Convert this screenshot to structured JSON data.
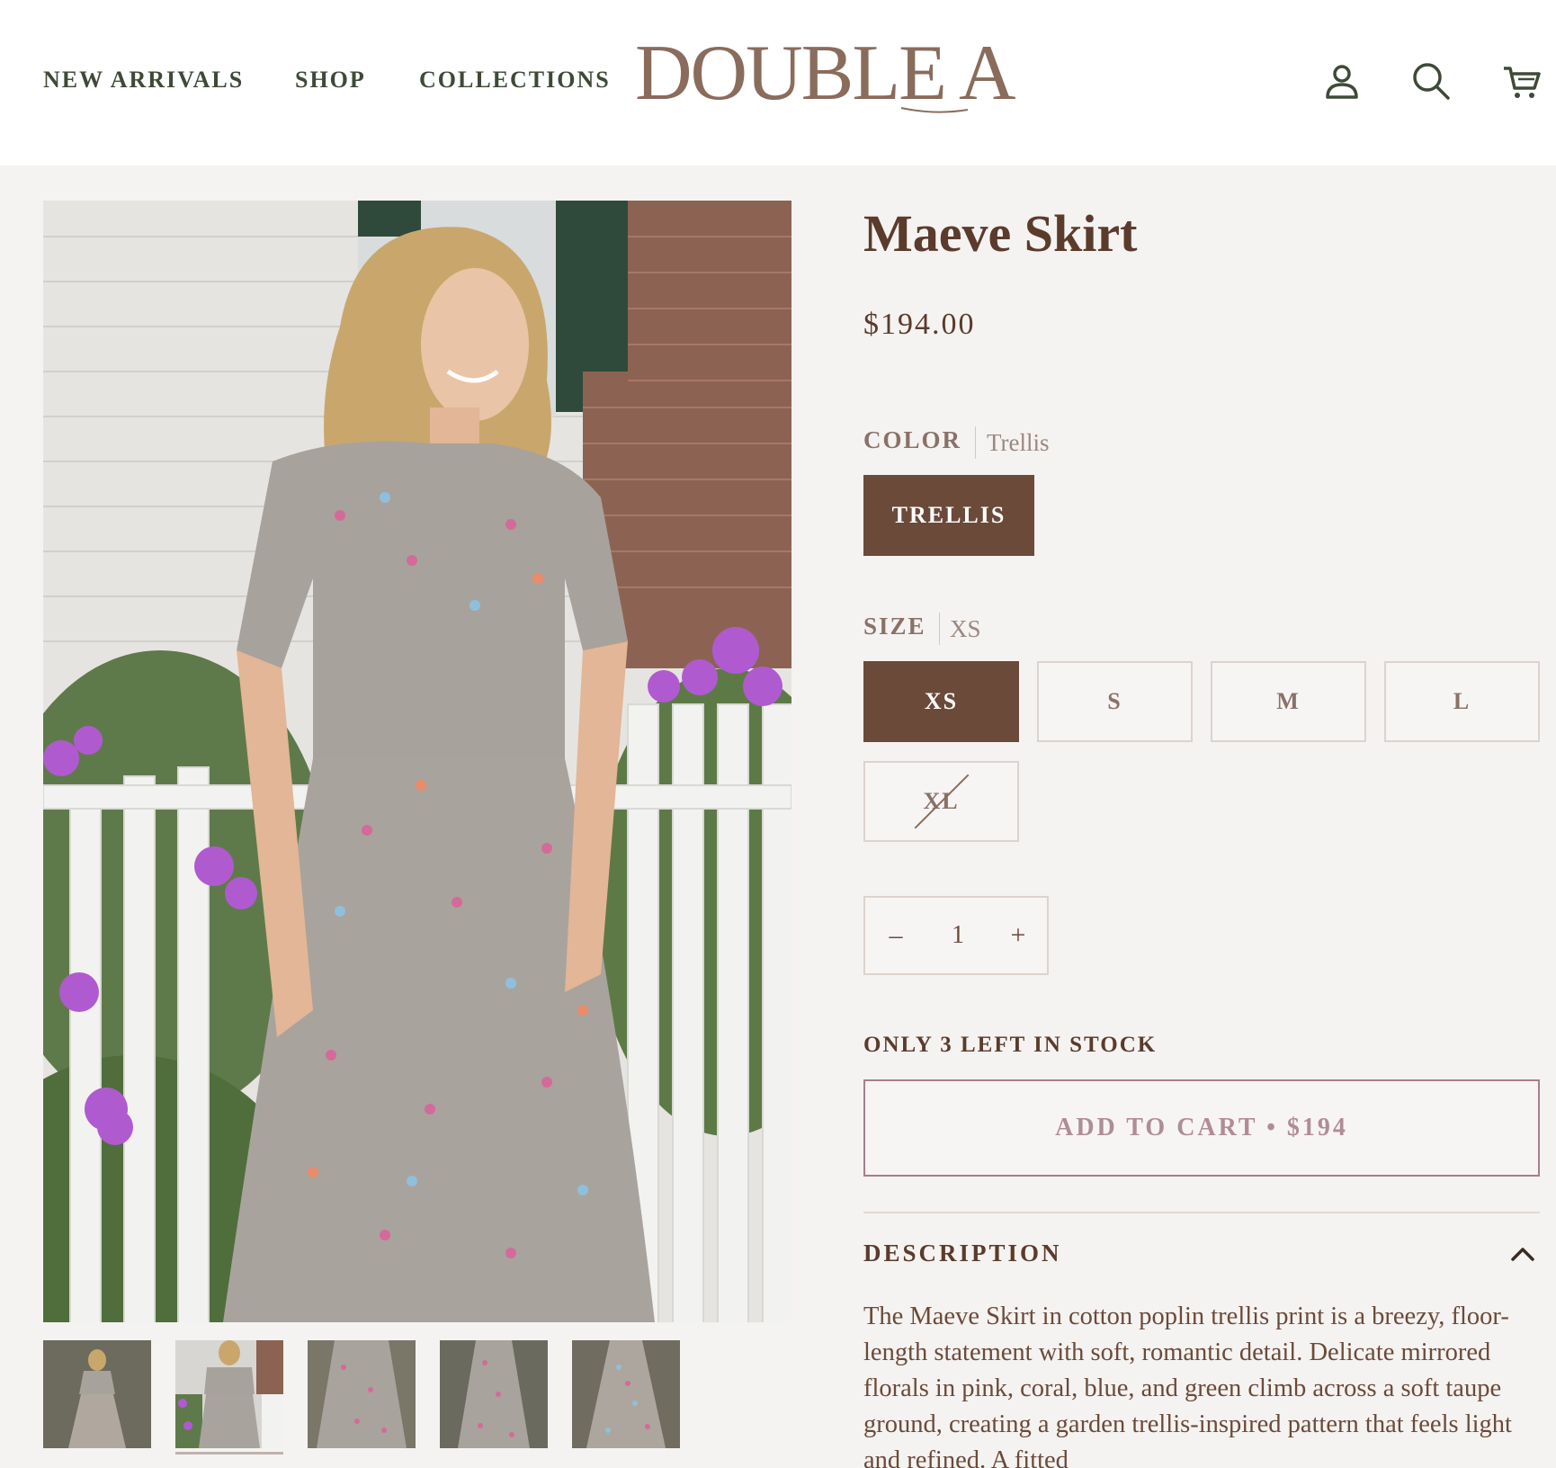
{
  "header": {
    "nav": [
      "NEW ARRIVALS",
      "SHOP",
      "COLLECTIONS"
    ],
    "logo": "DOUBLE A",
    "icons": [
      "account-icon",
      "search-icon",
      "cart-icon"
    ]
  },
  "gallery": {
    "thumbnail_count": 5,
    "active_thumbnail": 2
  },
  "product": {
    "title": "Maeve Skirt",
    "price": "$194.00",
    "color_label": "COLOR",
    "color_value": "Trellis",
    "color_options": [
      "TRELLIS"
    ],
    "size_label": "SIZE",
    "size_value": "XS",
    "size_options": [
      "XS",
      "S",
      "M",
      "L",
      "XL"
    ],
    "sold_out_sizes": [
      "XL"
    ],
    "quantity": {
      "minus": "–",
      "value": "1",
      "plus": "+"
    },
    "stock_text": "ONLY 3 LEFT IN STOCK",
    "add_to_cart": "ADD TO CART • $194",
    "description_heading": "DESCRIPTION",
    "description": "The Maeve Skirt in cotton poplin trellis print is a breezy, floor-length statement with soft, romantic detail. Delicate mirrored florals in pink, coral, blue, and green climb across a soft taupe ground, creating a garden trellis-inspired pattern that feels light and refined. A fitted"
  },
  "colors": {
    "header_bg": "#ffffff",
    "page_bg": "#f5f3f1",
    "brand_brown": "#6b4a3a",
    "nav_green": "#3e4a37",
    "cart_border": "#a67e8f"
  }
}
